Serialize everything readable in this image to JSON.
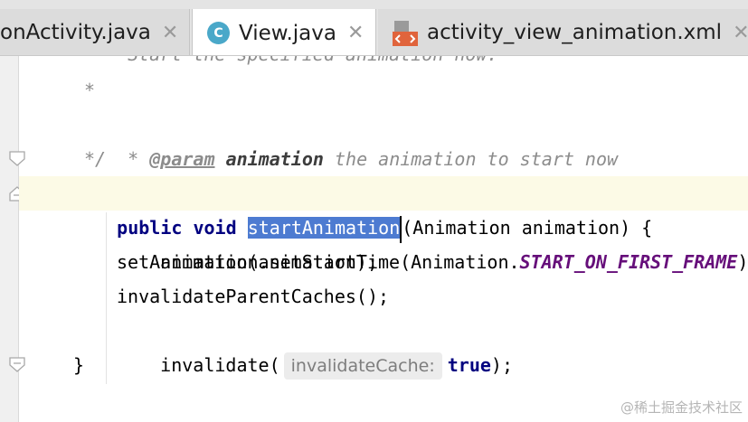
{
  "tabs": [
    {
      "label": "onActivity.java",
      "active": false,
      "icon": "none"
    },
    {
      "label": "View.java",
      "active": true,
      "icon": "java-class-icon"
    },
    {
      "label": "activity_view_animation.xml",
      "active": false,
      "icon": "xml-layout-icon"
    }
  ],
  "close_glyph": "✕",
  "class_icon_letter": "C",
  "code": {
    "l0": "* Start the specified animation now.",
    "l1": "*",
    "l2_star": "* ",
    "l2_tag": "@param",
    "l2_name": "animation",
    "l2_desc": "the animation to start now",
    "l3": "*/",
    "l4_kw1": "public",
    "l4_kw2": "void",
    "l4_method": "startAnimation",
    "l4_rest": "(Animation animation) {",
    "l5_pre": "animation.setStartTime(Animation.",
    "l5_const": "START_ON_FIRST_FRAME",
    "l5_post": ");",
    "l6": "setAnimation(animation);",
    "l7": "invalidateParentCaches();",
    "l8_pre": "invalidate(",
    "l8_hint": "invalidateCache:",
    "l8_kw": "true",
    "l8_post": ");",
    "l9": "}"
  },
  "watermark": "@稀土掘金技术社区",
  "colors": {
    "keyword": "#000080",
    "comment": "#8c8c8c",
    "constant": "#660e7a",
    "selection": "#2f65ca",
    "caret_row": "#fcfae6"
  }
}
